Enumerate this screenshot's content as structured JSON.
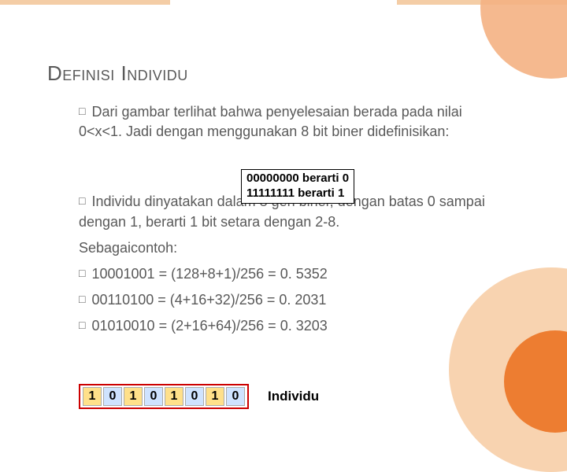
{
  "title": "Definisi Individu",
  "para1_lead": "Dari",
  "para1_rest": " gambar terlihat bahwa penyelesaian berada pada nilai 0<x<1. Jadi dengan menggunakan 8 bit biner didefinisikan:",
  "berarti_l1": "00000000 berarti 0",
  "berarti_l2": "11111111 berarti 1",
  "para2_lead": "Individu",
  "para2_rest": " dinyatakan dalam 8 gen biner, dengan batas 0 sampai dengan 1, berarti 1 bit setara dengan 2-8.",
  "contoh_label": "Sebagaicontoh:",
  "ex1_lead": "10001001",
  "ex1_rest": " = (128+8+1)/256 = 0. 5352",
  "ex2_lead": "00110100",
  "ex2_rest": " = (4+16+32)/256 = 0. 2031",
  "ex3_lead": "01010010",
  "ex3_rest": " = (2+16+64)/256 = 0. 3203",
  "bits": {
    "b0": "1",
    "b1": "0",
    "b2": "1",
    "b3": "0",
    "b4": "1",
    "b5": "0",
    "b6": "1",
    "b7": "0"
  },
  "individu_label": "Individu"
}
